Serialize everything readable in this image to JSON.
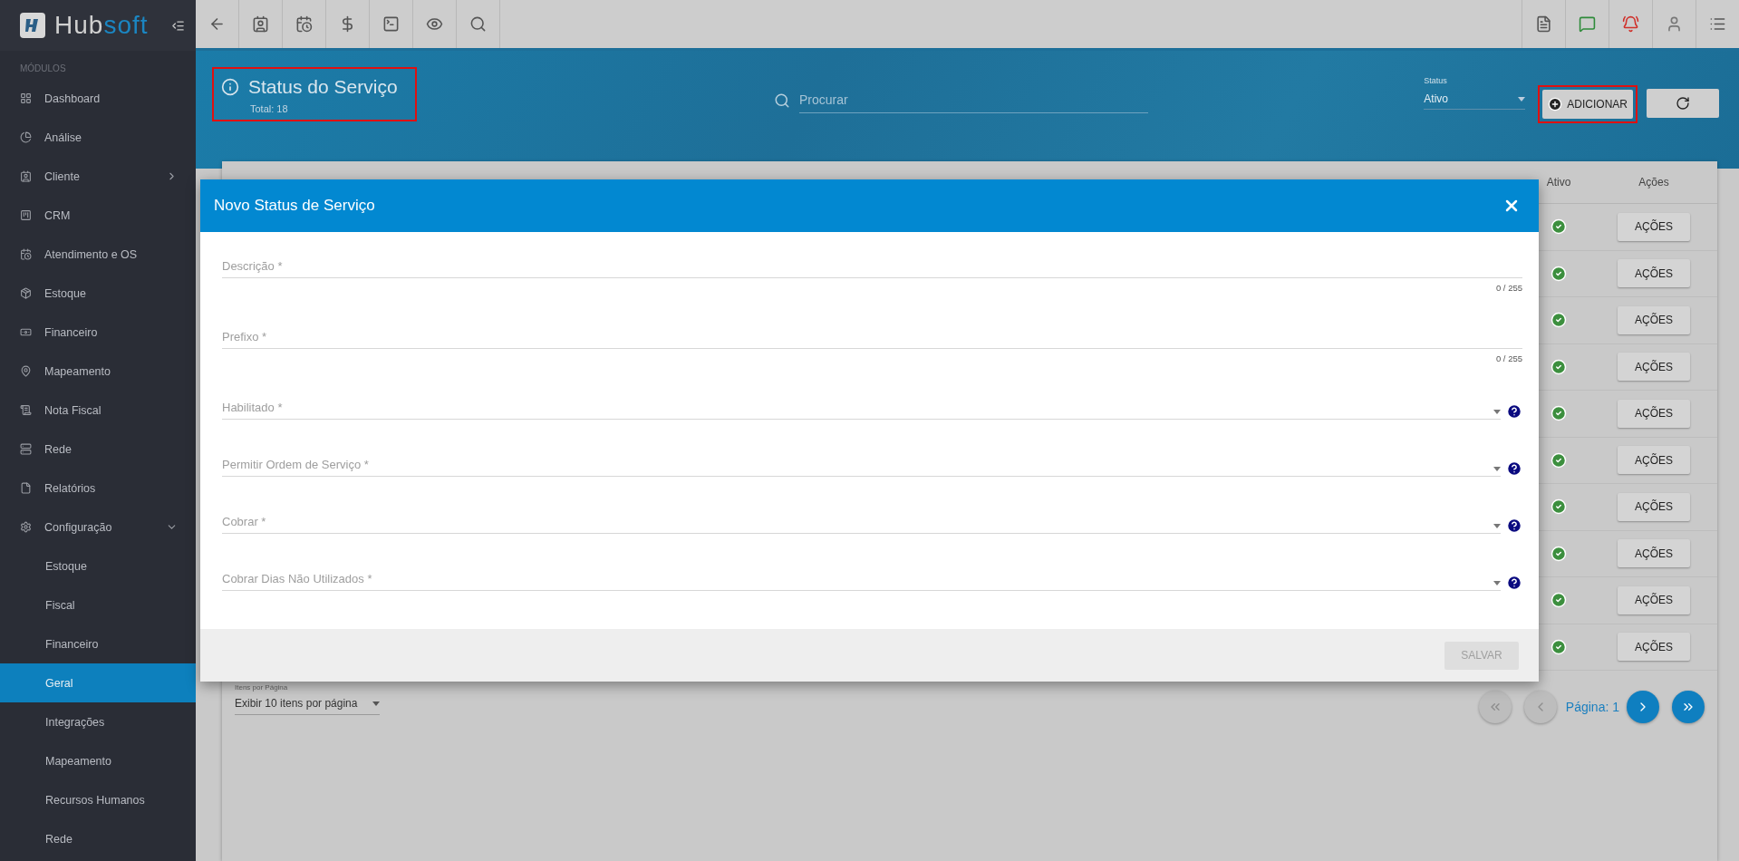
{
  "sidebar": {
    "logo": {
      "prefix": "Hub",
      "suffix": "soft"
    },
    "section": "MÓDULOS",
    "items": [
      {
        "label": "Dashboard",
        "selected": false
      },
      {
        "label": "Análise",
        "selected": false
      },
      {
        "label": "Cliente",
        "expanded": false,
        "selected": false
      },
      {
        "label": "CRM",
        "selected": false
      },
      {
        "label": "Atendimento e OS",
        "selected": false
      },
      {
        "label": "Estoque",
        "selected": false
      },
      {
        "label": "Financeiro",
        "selected": false
      },
      {
        "label": "Mapeamento",
        "selected": false
      },
      {
        "label": "Nota Fiscal",
        "selected": false
      },
      {
        "label": "Rede",
        "selected": false
      },
      {
        "label": "Relatórios",
        "selected": false
      },
      {
        "label": "Configuração",
        "expanded": true,
        "selected": false,
        "children": [
          {
            "label": "Estoque",
            "selected": false
          },
          {
            "label": "Fiscal",
            "selected": false
          },
          {
            "label": "Financeiro",
            "selected": false
          },
          {
            "label": "Geral",
            "selected": true
          },
          {
            "label": "Integrações",
            "selected": false
          },
          {
            "label": "Mapeamento",
            "selected": false
          },
          {
            "label": "Recursos Humanos",
            "selected": false
          },
          {
            "label": "Rede",
            "selected": false
          }
        ]
      }
    ]
  },
  "header": {
    "title": "Status do Serviço",
    "total": "Total: 18",
    "highlighted": true,
    "search": {
      "placeholder": "Procurar"
    },
    "status_filter": {
      "label": "Status",
      "value": "Ativo"
    },
    "add_button": {
      "label": "ADICIONAR",
      "highlighted": true
    }
  },
  "table": {
    "columns": [
      "Ativo",
      "Ações"
    ],
    "rows": [
      {
        "active": true,
        "action": "AÇÕES"
      },
      {
        "active": true,
        "action": "AÇÕES"
      },
      {
        "active": true,
        "action": "AÇÕES"
      },
      {
        "active": true,
        "action": "AÇÕES"
      },
      {
        "active": true,
        "action": "AÇÕES"
      },
      {
        "active": true,
        "action": "AÇÕES"
      },
      {
        "active": true,
        "action": "AÇÕES"
      },
      {
        "active": true,
        "action": "AÇÕES"
      },
      {
        "active": true,
        "action": "AÇÕES"
      },
      {
        "active": true,
        "action": "AÇÕES"
      }
    ]
  },
  "pagination": {
    "per_page_label": "Itens por Página",
    "per_page_value": "Exibir 10 itens por página",
    "page": "Página: 1",
    "first_disabled": true,
    "prev_disabled": true,
    "next_disabled": false,
    "last_disabled": false
  },
  "dialog": {
    "title": "Novo Status de Serviço",
    "fields": [
      {
        "kind": "text",
        "label": "Descrição *",
        "counter": "0 / 255"
      },
      {
        "kind": "text",
        "label": "Prefixo *",
        "counter": "0 / 255"
      },
      {
        "kind": "select",
        "label": "Habilitado *"
      },
      {
        "kind": "select",
        "label": "Permitir Ordem de Serviço *"
      },
      {
        "kind": "select",
        "label": "Cobrar *"
      },
      {
        "kind": "select",
        "label": "Cobrar Dias Não Utilizados *"
      }
    ],
    "save": {
      "label": "SALVAR",
      "disabled": true
    }
  }
}
